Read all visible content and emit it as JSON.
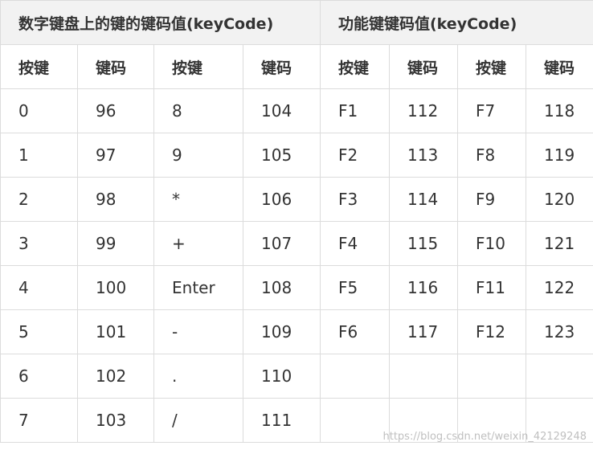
{
  "group_headers": {
    "numpad": "数字键盘上的键的键码值(keyCode)",
    "function": "功能键键码值(keyCode)"
  },
  "column_headers": [
    "按键",
    "键码",
    "按键",
    "键码",
    "按键",
    "键码",
    "按键",
    "键码"
  ],
  "rows": [
    [
      "0",
      "96",
      "8",
      "104",
      "F1",
      "112",
      "F7",
      "118"
    ],
    [
      "1",
      "97",
      "9",
      "105",
      "F2",
      "113",
      "F8",
      "119"
    ],
    [
      "2",
      "98",
      "*",
      "106",
      "F3",
      "114",
      "F9",
      "120"
    ],
    [
      "3",
      "99",
      "+",
      "107",
      "F4",
      "115",
      "F10",
      "121"
    ],
    [
      "4",
      "100",
      "Enter",
      "108",
      "F5",
      "116",
      "F11",
      "122"
    ],
    [
      "5",
      "101",
      "-",
      "109",
      "F6",
      "117",
      "F12",
      "123"
    ],
    [
      "6",
      "102",
      ".",
      "110",
      "",
      "",
      "",
      ""
    ],
    [
      "7",
      "103",
      "/",
      "111",
      "",
      "",
      "",
      ""
    ]
  ],
  "watermark": "https://blog.csdn.net/weixin_42129248"
}
